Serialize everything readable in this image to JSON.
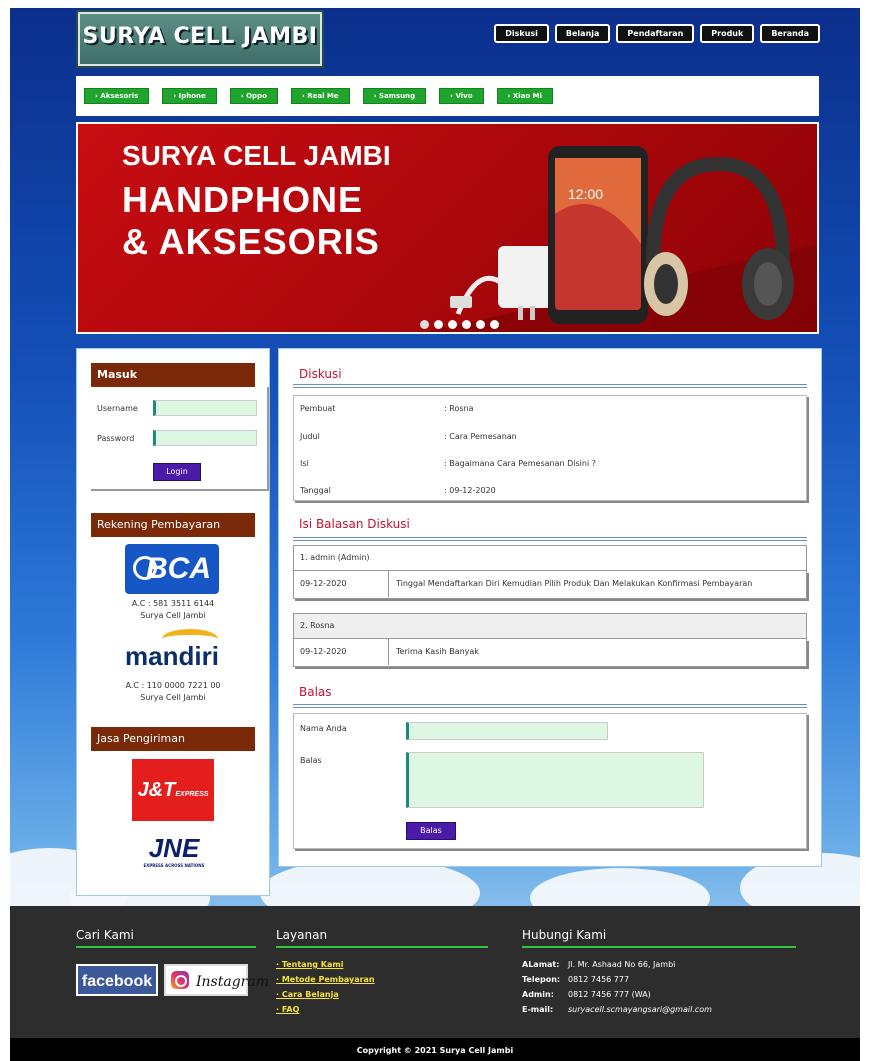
{
  "header": {
    "logo": "SURYA CELL JAMBI",
    "nav": [
      "Diskusi",
      "Belanja",
      "Pendaftaran",
      "Produk",
      "Beranda"
    ]
  },
  "categories": [
    "› Aksesoris",
    "› Iphone",
    "› Oppo",
    "› Real Me",
    "› Samsung",
    "› Vivo",
    "› Xiao Mi"
  ],
  "banner": {
    "line1": "SURYA CELL JAMBI",
    "line2": "HANDPHONE",
    "line3": "& AKSESORIS",
    "phone_time": "12:00"
  },
  "sidebar": {
    "login_title": "Masuk",
    "username_label": "Username",
    "password_label": "Password",
    "login_button": "Login",
    "rekening_title": "Rekening Pembayaran",
    "bca_logo": "BCA",
    "bca_account": "A.C : 581 3511 6144",
    "bca_name": "Surya Cell Jambi",
    "mandiri_logo": "mandiri",
    "mandiri_account": "A.C : 110 0000 7221 00",
    "mandiri_name": "Surya Cell Jambi",
    "pengiriman_title": "Jasa Pengiriman",
    "jnt_logo": "J&T",
    "jnt_sub": "EXPRESS",
    "jne_logo": "JNE",
    "jne_sub": "EXPRESS ACROSS NATIONS"
  },
  "diskusi": {
    "title": "Diskusi",
    "rows": [
      {
        "label": "Pembuat",
        "value": ": Rosna"
      },
      {
        "label": "Judul",
        "value": ": Cara Pemesanan"
      },
      {
        "label": "Isi",
        "value": ": Bagaimana Cara Pemesanan Disini ?"
      },
      {
        "label": "Tanggal",
        "value": ": 09-12-2020"
      }
    ]
  },
  "balasan": {
    "title": "Isi Balasan Diskusi",
    "items": [
      {
        "header": "1. admin (Admin)",
        "date": "09-12-2020",
        "message": "Tinggal Mendaftarkan Diri Kemudian Pilih Produk Dan Melakukan Konfirmasi Pembayaran"
      },
      {
        "header": "2. Rosna",
        "date": "09-12-2020",
        "message": "Terima Kasih Banyak"
      }
    ]
  },
  "balas": {
    "title": "Balas",
    "name_label": "Nama Anda",
    "reply_label": "Balas",
    "button": "Balas"
  },
  "footer": {
    "cari_title": "Cari Kami",
    "facebook": "facebook",
    "instagram": "Instagram",
    "layanan_title": "Layanan",
    "layanan": [
      "· Tentang Kami",
      "· Metode Pembayaran",
      "· Cara Belanja",
      "· FAQ"
    ],
    "hubungi_title": "Hubungi Kami",
    "alamat_label": "ALamat:",
    "alamat": "Jl. Mr. Ashaad No 66, Jambi",
    "telepon_label": "Telepon:",
    "telepon": "0812 7456 777",
    "admin_label": "Admin:",
    "admin": "0812 7456 777 (WA)",
    "email_label": "E-mail:",
    "email": "suryacell.scmayangsari@gmail.com",
    "copyright": "Copyright © 2021 Surya Cell Jambi"
  },
  "colors": {
    "header_green": "#3f6f67",
    "category_green": "#1fa52c",
    "title_brown": "#7a2a08",
    "section_red": "#c8102e",
    "button_purple": "#4b1aa8",
    "footer_bg": "#2d2d2d",
    "footer_accent": "#36c23f"
  }
}
